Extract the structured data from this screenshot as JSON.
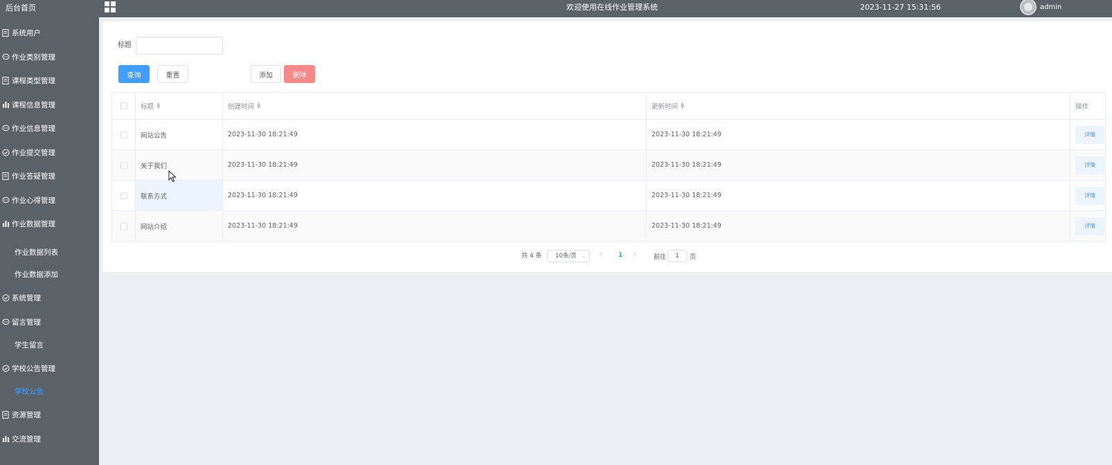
{
  "sidebar": {
    "home": "后台首页",
    "items": [
      {
        "label": "系统用户",
        "icon": "document-icon"
      },
      {
        "label": "作业类别管理",
        "icon": "chat-icon"
      },
      {
        "label": "课程类型管理",
        "icon": "document-icon"
      },
      {
        "label": "课程信息管理",
        "icon": "bar-chart-icon"
      },
      {
        "label": "作业信息管理",
        "icon": "chat-icon"
      },
      {
        "label": "作业提交管理",
        "icon": "check-circle-icon"
      },
      {
        "label": "作业答疑管理",
        "icon": "document-icon"
      },
      {
        "label": "作业心得管理",
        "icon": "chat-icon"
      },
      {
        "label": "作业数据管理",
        "icon": "bar-chart-icon"
      },
      {
        "label": "系统管理",
        "icon": "check-circle-icon"
      },
      {
        "label": "留言管理",
        "icon": "chat-icon"
      },
      {
        "label": "学校公告管理",
        "icon": "check-circle-icon"
      },
      {
        "label": "资源管理",
        "icon": "document-icon"
      },
      {
        "label": "交流管理",
        "icon": "bar-chart-icon"
      }
    ],
    "subs": {
      "data_list": "作业数据列表",
      "data_add": "作业数据添加",
      "student_msg": "学生留言",
      "school_notice": "学校公告"
    }
  },
  "header": {
    "title": "欢迎使用在线作业管理系统",
    "datetime": "2023-11-27 15:31:56",
    "user": "admin"
  },
  "search": {
    "label": "标题",
    "value": "",
    "query_btn": "查询",
    "reset_btn": "重置",
    "add_btn": "添加",
    "delete_btn": "删除"
  },
  "table": {
    "columns": [
      "标题",
      "创建时间",
      "更新时间",
      "操作"
    ],
    "rows": [
      {
        "title": "网站公告",
        "created": "2023-11-30 18:21:49",
        "updated": "2023-11-30 18:21:49",
        "action": "详情"
      },
      {
        "title": "关于我们",
        "created": "2023-11-30 18:21:49",
        "updated": "2023-11-30 18:21:49",
        "action": "详情"
      },
      {
        "title": "联系方式",
        "created": "2023-11-30 18:21:49",
        "updated": "2023-11-30 18:21:49",
        "action": "详情"
      },
      {
        "title": "网站介绍",
        "created": "2023-11-30 18:21:49",
        "updated": "2023-11-30 18:21:49",
        "action": "详情"
      }
    ]
  },
  "pagination": {
    "total": "共 4 条",
    "page_size": "10条/页",
    "current_page": "1",
    "goto_label": "前往",
    "goto_value": "1",
    "page_unit": "页"
  },
  "colors": {
    "sidebar_bg": "#5a6268",
    "primary": "#409eff",
    "danger": "#f78989",
    "page_bg": "#eeeff3"
  }
}
